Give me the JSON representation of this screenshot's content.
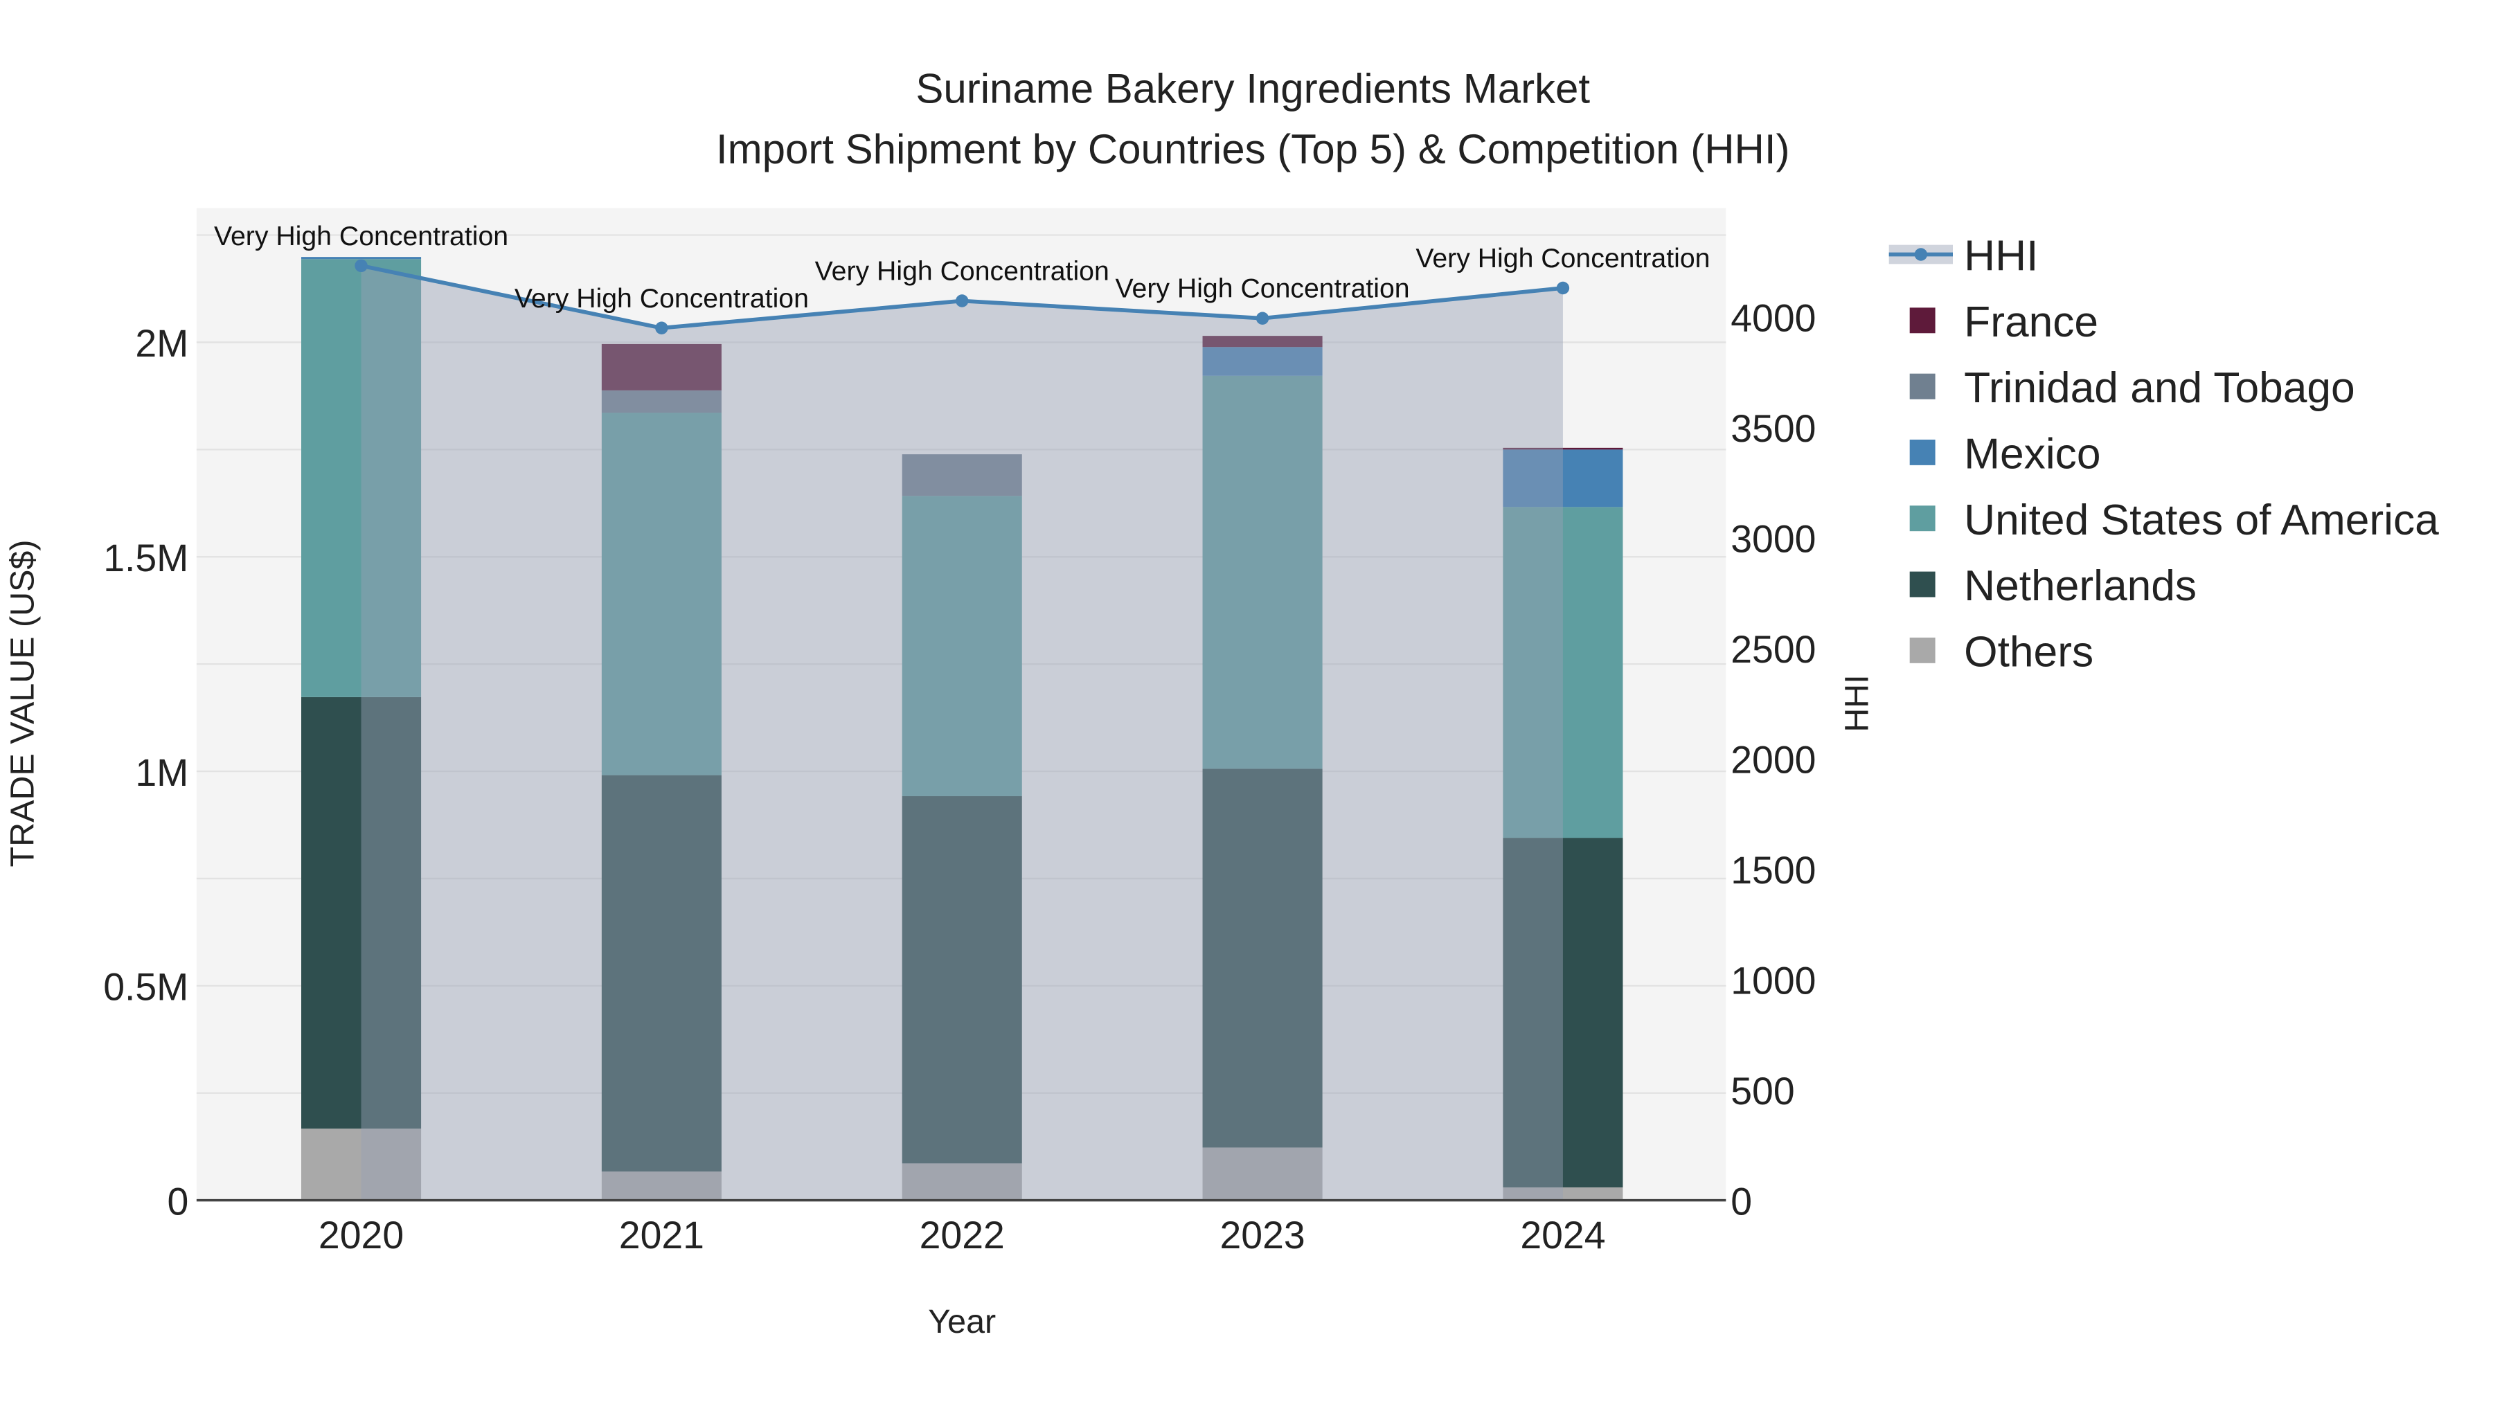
{
  "chart_data": {
    "type": "bar",
    "stacked": true,
    "title": "Suriname Bakery Ingredients Market",
    "subtitle": "Import Shipment by Countries (Top 5) & Competition (HHI)",
    "xlabel": "Year",
    "ylabel": "TRADE VALUE (US$)",
    "y2label": "HHI",
    "categories": [
      "2020",
      "2021",
      "2022",
      "2023",
      "2024"
    ],
    "ylim": [
      0,
      2300000
    ],
    "y2lim": [
      0,
      4450
    ],
    "yticks": [
      {
        "v": 0,
        "label": "0"
      },
      {
        "v": 500000,
        "label": "0.5M"
      },
      {
        "v": 1000000,
        "label": "1M"
      },
      {
        "v": 1500000,
        "label": "1.5M"
      },
      {
        "v": 2000000,
        "label": "2M"
      }
    ],
    "y2ticks": [
      0,
      500,
      1000,
      1500,
      2000,
      2500,
      3000,
      3500,
      4000
    ],
    "series": [
      {
        "name": "Others",
        "color": "#a9a9a9",
        "values": [
          167000,
          67000,
          86000,
          123000,
          30000
        ]
      },
      {
        "name": "Netherlands",
        "color": "#2f4f4f",
        "values": [
          1006000,
          924000,
          856000,
          883000,
          815000
        ]
      },
      {
        "name": "United States of America",
        "color": "#5f9ea0",
        "values": [
          1021000,
          845000,
          700000,
          916000,
          771000
        ]
      },
      {
        "name": "Mexico",
        "color": "#4682b4",
        "values": [
          5000,
          0,
          0,
          67000,
          134000
        ]
      },
      {
        "name": "Trinidad and Tobago",
        "color": "#708090",
        "values": [
          0,
          52000,
          97000,
          0,
          0
        ]
      },
      {
        "name": "France",
        "color": "#5e1a3a",
        "values": [
          0,
          108000,
          0,
          26000,
          4000
        ]
      }
    ],
    "hhi": {
      "name": "HHI",
      "color": "#4682b4",
      "values": [
        4231,
        3949,
        4072,
        3993,
        4130
      ],
      "annotations": [
        "Very High Concentration",
        "Very High Concentration",
        "Very High Concentration",
        "Very High Concentration",
        "Very High Concentration"
      ]
    },
    "legend": {
      "placement": "right",
      "items": [
        "HHI",
        "France",
        "Trinidad and Tobago",
        "Mexico",
        "United States of America",
        "Netherlands",
        "Others"
      ]
    },
    "grid": true
  }
}
